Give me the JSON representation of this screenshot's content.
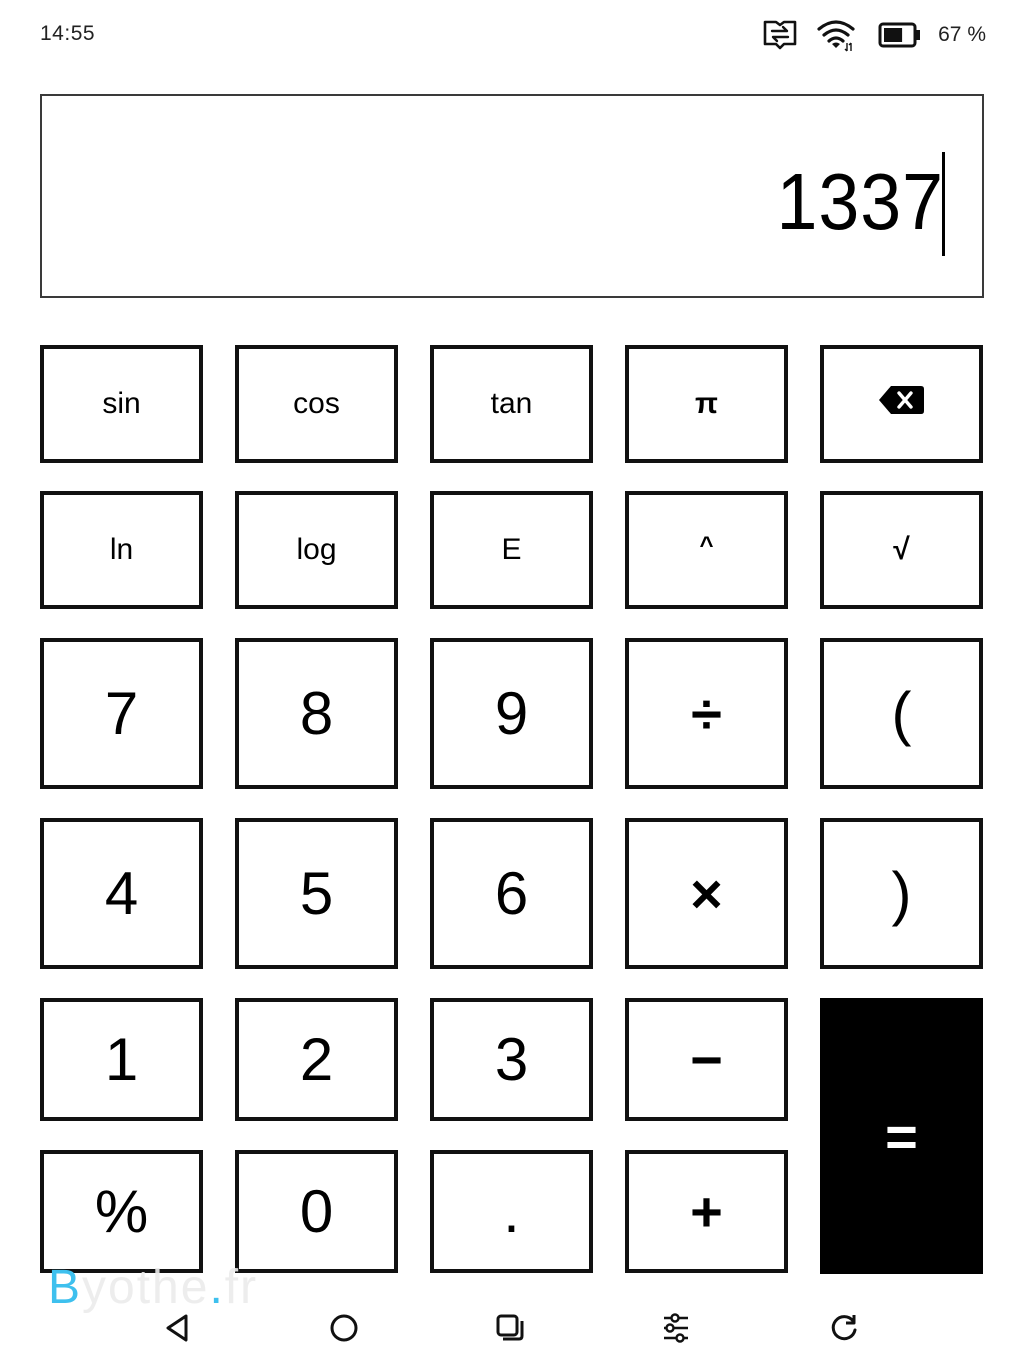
{
  "status_bar": {
    "time": "14:55",
    "icons": [
      "sync-icon",
      "wifi-icon",
      "battery-icon"
    ],
    "battery_percent": 67,
    "battery_label": "67 %"
  },
  "display": {
    "value": "1337",
    "cursor_visible": true
  },
  "keypad": {
    "rows": [
      [
        {
          "label": "sin",
          "name": "sin"
        },
        {
          "label": "cos",
          "name": "cos"
        },
        {
          "label": "tan",
          "name": "tan"
        },
        {
          "label": "π",
          "name": "pi"
        },
        {
          "label": "",
          "name": "backspace",
          "icon": "backspace-icon"
        }
      ],
      [
        {
          "label": "ln",
          "name": "ln"
        },
        {
          "label": "log",
          "name": "log"
        },
        {
          "label": "E",
          "name": "exponent"
        },
        {
          "label": "^",
          "name": "power"
        },
        {
          "label": "√",
          "name": "sqrt"
        }
      ],
      [
        {
          "label": "7",
          "name": "7"
        },
        {
          "label": "8",
          "name": "8"
        },
        {
          "label": "9",
          "name": "9"
        },
        {
          "label": "÷",
          "name": "divide"
        },
        {
          "label": "(",
          "name": "open-paren"
        }
      ],
      [
        {
          "label": "4",
          "name": "4"
        },
        {
          "label": "5",
          "name": "5"
        },
        {
          "label": "6",
          "name": "6"
        },
        {
          "label": "×",
          "name": "multiply"
        },
        {
          "label": ")",
          "name": "close-paren"
        }
      ],
      [
        {
          "label": "1",
          "name": "1"
        },
        {
          "label": "2",
          "name": "2"
        },
        {
          "label": "3",
          "name": "3"
        },
        {
          "label": "−",
          "name": "minus"
        }
      ],
      [
        {
          "label": "%",
          "name": "percent"
        },
        {
          "label": "0",
          "name": "0"
        },
        {
          "label": ".",
          "name": "decimal"
        },
        {
          "label": "+",
          "name": "plus"
        }
      ]
    ],
    "equals": {
      "label": "=",
      "name": "equals"
    }
  },
  "nav_bar": {
    "buttons": [
      {
        "name": "back",
        "icon": "back-triangle-icon"
      },
      {
        "name": "home",
        "icon": "home-circle-icon"
      },
      {
        "name": "recents",
        "icon": "recents-square-icon"
      },
      {
        "name": "settings",
        "icon": "sliders-icon"
      },
      {
        "name": "refresh",
        "icon": "refresh-icon"
      }
    ]
  },
  "watermark": {
    "first": "B",
    "middle": "yothe",
    "dot": ".",
    "last": "fr"
  }
}
